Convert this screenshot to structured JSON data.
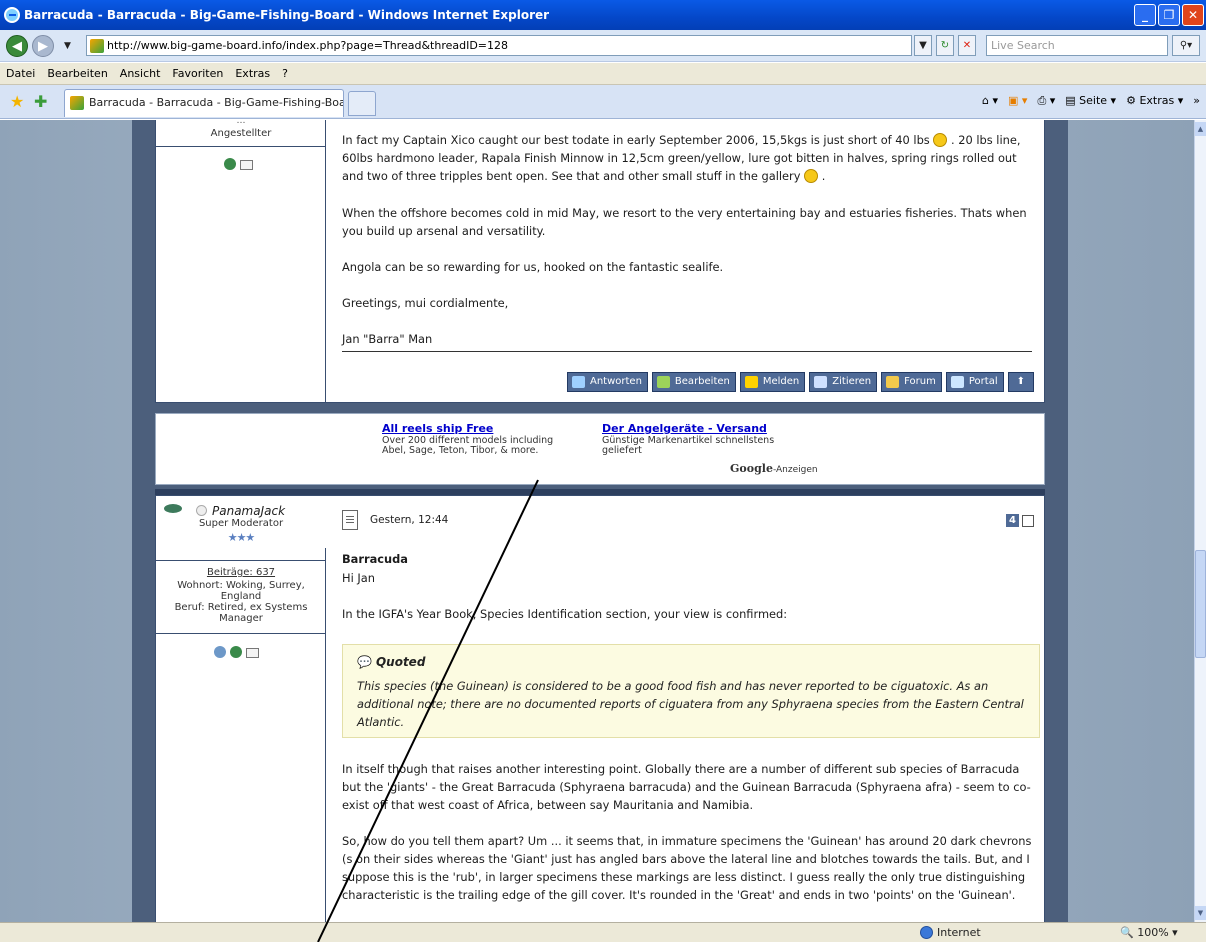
{
  "window": {
    "title": "Barracuda - Barracuda - Big-Game-Fishing-Board - Windows Internet Explorer"
  },
  "address": {
    "url": "http://www.big-game-board.info/index.php?page=Thread&threadID=128",
    "search_placeholder": "Live Search"
  },
  "menu": [
    "Datei",
    "Bearbeiten",
    "Ansicht",
    "Favoriten",
    "Extras",
    "?"
  ],
  "tabs": [
    {
      "label": "Barracuda - Barracuda - Big-Game-Fishing-Board"
    }
  ],
  "commandbar": {
    "page": "Seite",
    "tools": "Extras"
  },
  "post1": {
    "user_title": "Angestellter",
    "paragraphs": [
      "In fact my Captain Xico caught our best todate in early September 2006, 15,5kgs is just short of 40 lbs",
      ". 20 lbs line, 60lbs hardmono leader, Rapala Finish Minnow in 12,5cm green/yellow, lure got bitten in halves, spring rings rolled out and two of three tripples bent open. See that and other small stuff in the gallery",
      "When the offshore becomes cold in mid May, we resort to the very entertaining bay and estuaries fisheries. Thats when you build up arsenal and versatility.",
      "Angola can be so rewarding for us, hooked on the fantastic sealife.",
      "Greetings, mui cordialmente,",
      "Jan \"Barra\" Man"
    ],
    "buttons": [
      "Antworten",
      "Bearbeiten",
      "Melden",
      "Zitieren",
      "Forum",
      "Portal"
    ]
  },
  "ads": {
    "ad1": {
      "title": "All reels ship Free",
      "line1": "Over 200 different models including",
      "line2": "Abel, Sage, Teton, Tibor, & more."
    },
    "ad2": {
      "title": "Der Angelgeräte - Versand",
      "line1": "Günstige Markenartikel schnellstens",
      "line2": "geliefert"
    },
    "google": "Google",
    "google_suffix": "-Anzeigen"
  },
  "post2": {
    "username": "PanamaJack",
    "rank": "Super Moderator",
    "posts": "Beiträge: 637",
    "location1": "Wohnort: Woking, Surrey,",
    "location2": "England",
    "job1": "Beruf: Retired, ex Systems",
    "job2": "Manager",
    "date": "Gestern, 12:44",
    "post_number": "4",
    "subject": "Barracuda",
    "greeting": "Hi Jan",
    "p1": "In the IGFA's Year Book, Species Identification section, your view is confirmed:",
    "quote_title": "Quoted",
    "quote_body": "This species (the Guinean) is considered to be a good food fish and has never reported to be ciguatoxic. As an additional note; there are no documented reports of ciguatera from any Sphyraena species from the Eastern Central Atlantic.",
    "p2": "In itself though that raises another interesting point. Globally there are a number of different sub species of Barracuda but the 'giants' - the Great Barracuda (Sphyraena barracuda) and the Guinean Barracuda (Sphyraena afra) - seem to co-exist off that west coast of Africa, between say Mauritania and Namibia.",
    "p3": "So, how do you tell them apart? Um ... it seems that, in immature specimens the 'Guinean' has around 20 dark chevrons (s on their sides whereas the 'Giant' just has angled bars above the lateral line and blotches towards the tails. But, and I suppose this is the 'rub', in larger specimens these markings are less distinct. I guess really the only true distinguishing characteristic is the trailing edge of the gill cover. It's rounded in the 'Great' and ends in two 'points' on the 'Guinean'."
  },
  "status": {
    "zone": "Internet",
    "zoom": "100%"
  }
}
